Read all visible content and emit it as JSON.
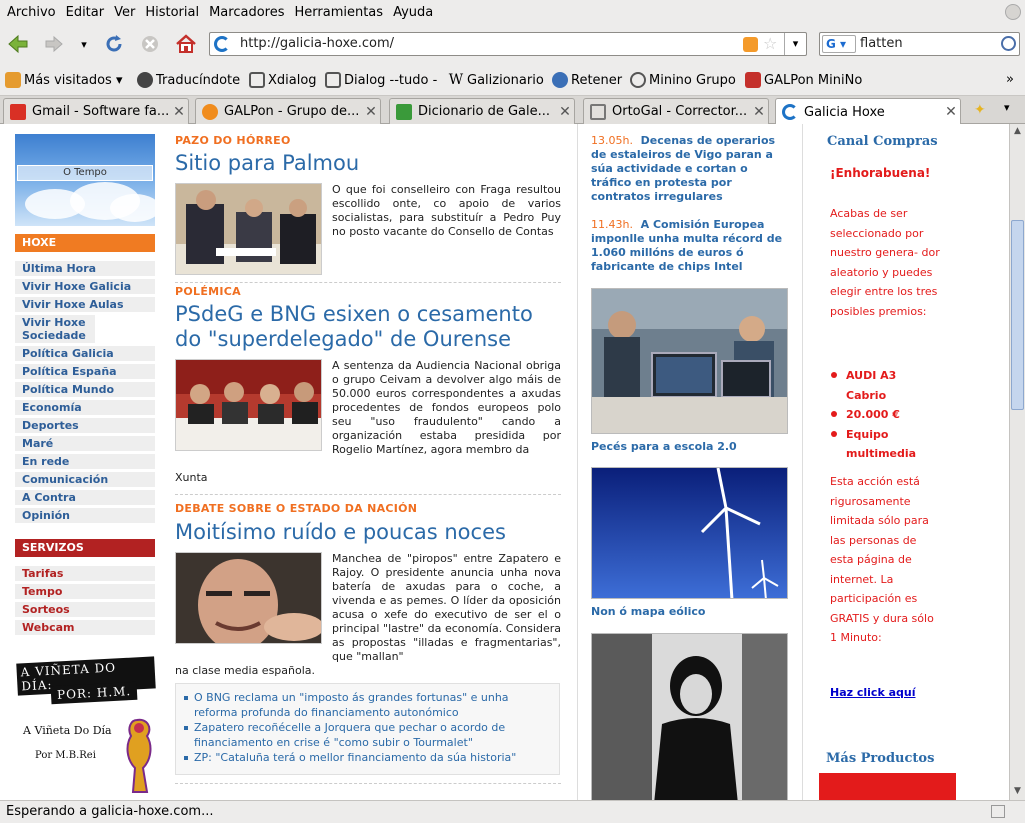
{
  "menubar": {
    "items": [
      "Archivo",
      "Editar",
      "Ver",
      "Historial",
      "Marcadores",
      "Herramientas",
      "Ayuda"
    ]
  },
  "navbar": {
    "url": "http://galicia-hoxe.com/",
    "search_value": "flatten",
    "search_engine": "G"
  },
  "bookmarks": [
    {
      "label": "Más visitados",
      "icon": "bookmark-folder-icon"
    },
    {
      "label": "Traducíndote",
      "icon": "bookmark-icon"
    },
    {
      "label": "Xdialog",
      "icon": "bookmark-icon"
    },
    {
      "label": "Dialog --tudo -",
      "icon": "bookmark-icon"
    },
    {
      "label": "Galizionario",
      "icon": "wikipedia-icon"
    },
    {
      "label": "Retener",
      "icon": "wordpress-icon"
    },
    {
      "label": "Minino Grupo",
      "icon": "bookmark-icon"
    },
    {
      "label": "GALPon MiniNo",
      "icon": "bookmark-icon"
    }
  ],
  "tabs": [
    {
      "label": "Gmail - Software fa...",
      "icon": "gmail-icon",
      "color": "#d93025"
    },
    {
      "label": "GALPon - Grupo de...",
      "icon": "galpon-icon",
      "color": "#f08c1d"
    },
    {
      "label": "Dicionario de Gale...",
      "icon": "dictionary-icon",
      "color": "#3a9a3a"
    },
    {
      "label": "OrtoGal - Corrector...",
      "icon": "ortogal-icon",
      "color": "#777777"
    },
    {
      "label": "Galicia Hoxe",
      "icon": "galicia-hoxe-icon",
      "color": "#1e73c6"
    }
  ],
  "status": "Esperando a galicia-hoxe.com...",
  "sidebar": {
    "tempo_label": "O Tempo",
    "hoxe_title": "HOXE",
    "hoxe_items": [
      "Última Hora",
      "Vivir Hoxe Galicia",
      "Vivir Hoxe Aulas",
      "Vivir Hoxe Sociedade",
      "Política Galicia",
      "Política España",
      "Política Mundo",
      "Economía",
      "Deportes",
      "Maré",
      "En rede",
      "Comunicación",
      "A Contra",
      "Opinión"
    ],
    "servizos_title": "SERVIZOS",
    "servizos_items": [
      "Tarifas",
      "Tempo",
      "Sorteos",
      "Webcam"
    ],
    "vineta_line1": "A VIÑETA DO DÍA:",
    "vineta_line2": "POR: H.M.",
    "vineta_line3": "A Viñeta Do Día",
    "vineta_line4": "Por M.B.Rei"
  },
  "articles": [
    {
      "kicker": "PAZO DO HÓRREO",
      "title": "Sitio para Palmou",
      "body": "O que foi conselleiro con Fraga resultou escollido onte, co apoio de varios socialistas, para substituír a Pedro Puy no posto vacante do Consello de Contas"
    },
    {
      "kicker": "POLÉMICA",
      "title": "PSdeG e BNG esixen o cesamento do \"superdelegado\" de Ourense",
      "body": "A sentenza da Audiencia Nacional obriga o grupo Ceivam a devolver algo máis de 50.000 euros correspondentes a axudas procedentes de fondos europeos polo seu \"uso fraudulento\" cando a organización estaba presidida por Rogelio Martínez, agora membro da",
      "body_tail": "Xunta"
    },
    {
      "kicker": "DEBATE SOBRE O ESTADO DA NACIÓN",
      "title": "Moitísimo ruído e poucas noces",
      "body": "Manchea de \"piropos\" entre Zapatero e Rajoy. O presidente anuncia unha nova batería de axudas para o coche, a vivenda e as pemes. O líder da oposición acusa o xefe do executivo de ser el o principal \"lastre\" da economía. Considera as propostas \"illadas e fragmentarias\", que \"mallan\"",
      "body_tail": "na clase media española."
    }
  ],
  "related": [
    "O BNG reclama un \"imposto ás grandes fortunas\" e unha reforma profunda do financiamento autonómico",
    "Zapatero recoñécelle a Jorquera que pechar o acordo de financiamento en crise é \"como subir o Tourmalet\"",
    "ZP: \"Cataluña terá o mellor financiamento da súa historia\""
  ],
  "briefs": [
    {
      "time": "13.05h.",
      "text": "Decenas de operarios de estaleiros de Vigo paran a súa actividade e cortan o tráfico en protesta por contratos irregulares"
    },
    {
      "time": "11.43h.",
      "text": "A Comisión Europea imponlle unha multa récord de 1.060 millóns de euros ó fabricante de chips Intel"
    }
  ],
  "captions": [
    "Pecés para a escola 2.0",
    "Non ó mapa eólico"
  ],
  "ad": {
    "canal_title": "Canal Compras",
    "congrats": "¡Enhorabuena!",
    "intro": "Acabas de ser seleccionado por nuestro genera- dor aleatorio y puedes elegir entre los tres posibles premios:",
    "prizes": [
      "AUDI A3 Cabrio",
      "20.000 €",
      "Equipo multimedia"
    ],
    "outro": "Esta acción está rigurosamente limitada sólo para las personas de esta página de internet. La participación es GRATIS y dura sólo 1 Minuto:",
    "link": "Haz click aquí",
    "more_title": "Más Productos"
  },
  "colors": {
    "accent_orange": "#f06f21",
    "link_blue": "#2b6aa8",
    "servizos_red": "#b22222",
    "ad_red": "#e31b1b"
  }
}
